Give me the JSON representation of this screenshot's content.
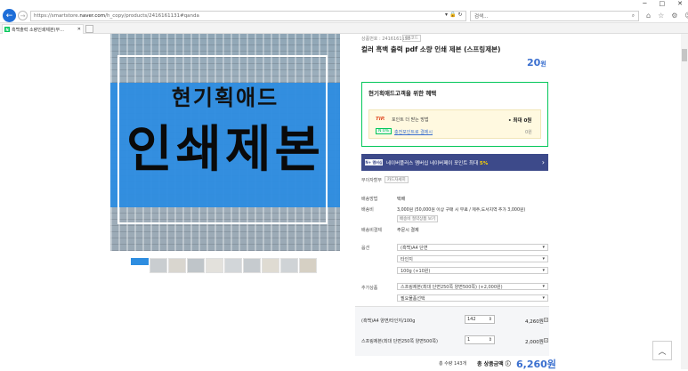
{
  "window": {
    "minimize": "─",
    "maximize": "□",
    "close": "✕"
  },
  "browser": {
    "url_prefix": "https://smartstore.",
    "url_domain": "naver.com",
    "url_path": "/h_copy/products/2416161131#qanda",
    "search_placeholder": "검색...",
    "tab_title": "흑백출력 소량인쇄제본(무..."
  },
  "product": {
    "code_label": "상품번호 : 2416161131",
    "code_badge": "QR코드",
    "title": "컬러 흑백 출력 pdf 소량 인쇄 제본 (스프링제본)",
    "price": "20",
    "price_unit": "원"
  },
  "hero": {
    "subtitle": "현기획애드",
    "main": "인쇄제본"
  },
  "benefit": {
    "title": "현기획애드고객을 위한 혜택",
    "tip_label": "TIP.",
    "tip_text": "포인트 더 받는 방법",
    "tip_max": "• 최대 0원",
    "badge": "N 0%",
    "link": "충전포인트로 결제시",
    "zero": "0원"
  },
  "promo": {
    "logo": "N+ 멤버십",
    "text": "네이버플러스 멤버십 네이버페이 포인트 최대",
    "pct": "5%",
    "arrow": "›"
  },
  "info": {
    "interest_label": "무이자할부",
    "interest_value": "카드자세히",
    "ship_method_label": "배송방법",
    "ship_method_value": "택배",
    "ship_fee_label": "배송비",
    "ship_fee_value": "3,000원 (50,000원 이상 구매 시 무료 / 제주,도서지역 추가 3,000원)",
    "ship_fee_pill": "배송비 절약상품 보기",
    "pay_label": "배송비결제",
    "pay_value": "주문시 결제"
  },
  "options": {
    "label": "옵션",
    "selects": [
      "(흑백)A4 단면",
      "타인지",
      "100g (+10원)"
    ],
    "extra_label": "추가상품",
    "extra_selects": [
      "스프링제본(최대 단면250쪽 양면500쪽) (+2,000원)",
      "필요물품선택"
    ]
  },
  "qty_rows": [
    {
      "name": "(흑백)A4 양면/타인지/100g",
      "qty": "142",
      "price": "4,260원"
    },
    {
      "name": "스프링제본(최대 단면250쪽 양면500쪽)",
      "qty": "1",
      "price": "2,000원"
    }
  ],
  "total": {
    "qty": "총 수량 143개",
    "label": "총 상품금액 ⓘ",
    "price": "6,260원"
  },
  "scroll_top": "︿"
}
